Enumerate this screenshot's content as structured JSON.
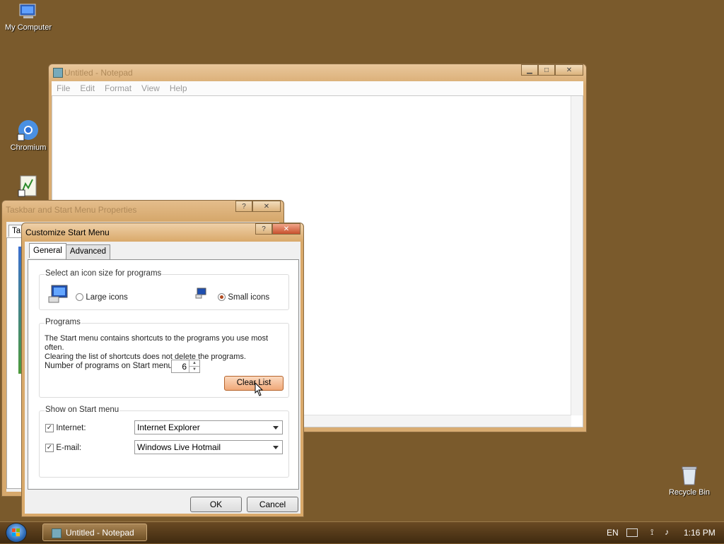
{
  "desktop": {
    "icons": [
      {
        "label": "My Computer"
      },
      {
        "label": "Chromium"
      },
      {
        "label": ""
      },
      {
        "label": "Recycle Bin"
      }
    ]
  },
  "notepad": {
    "title": "Untitled - Notepad",
    "menu": [
      "File",
      "Edit",
      "Format",
      "View",
      "Help"
    ]
  },
  "taskbar_props": {
    "title": "Taskbar and Start Menu Properties",
    "tab_partial": "Ta"
  },
  "customize": {
    "title": "Customize Start Menu",
    "tabs": [
      "General",
      "Advanced"
    ],
    "icon_size_group": {
      "title": "Select an icon size for programs",
      "large_label": "Large icons",
      "small_label": "Small icons",
      "selected": "Small icons"
    },
    "programs_group": {
      "title": "Programs",
      "desc_line1": "The Start menu contains shortcuts to the programs you use most often.",
      "desc_line2": "Clearing the list of shortcuts does not delete the programs.",
      "count_label": "Number of programs on Start menu:",
      "count_value": "6",
      "clear_button": "Clear List"
    },
    "show_group": {
      "title": "Show on Start menu",
      "internet_label": "Internet:",
      "internet_value": "Internet Explorer",
      "email_label": "E-mail:",
      "email_value": "Windows Live Hotmail",
      "internet_checked": true,
      "email_checked": true
    },
    "ok_button": "OK",
    "cancel_button": "Cancel"
  },
  "taskbar": {
    "task_label": "Untitled - Notepad",
    "lang": "EN",
    "clock": "1:16 PM"
  }
}
